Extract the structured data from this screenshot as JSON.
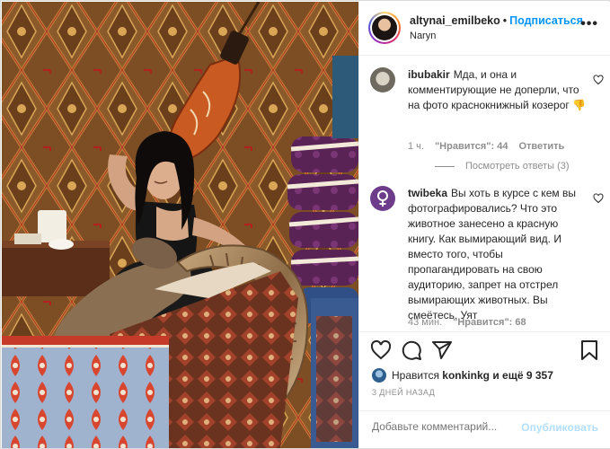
{
  "post": {
    "username": "altynai_emilbeko",
    "separator": "•",
    "follow_label": "Подписаться",
    "location": "Naryn",
    "more_glyph": "•••"
  },
  "comments": [
    {
      "username": "ibubakir",
      "text": "Мда, и она и комментирующие не доперли, что на фото краснокнижный козерог 👎",
      "time": "1 ч.",
      "likes": "\"Нравится\": 44",
      "reply": "Ответить"
    },
    {
      "username": "twibeka",
      "text": "Вы хоть в курсе с кем вы фотографировались? Что это животное занесено а красную книгу. Как вымирающий вид. И вместо того, чтобы пропагандировать на свою аудиторию, запрет на отстрел вымирающих животных. Вы смеётесь. Уят",
      "time": "43 мин.",
      "likes": "\"Нравится\": 68"
    }
  ],
  "replies_label": "Посмотреть ответы (3)",
  "likes": {
    "prefix": "Нравится",
    "user": "konkinkg",
    "and_more": "и ещё 9 357"
  },
  "date": "3 ДНЕЙ НАЗАД",
  "add_comment": {
    "placeholder": "Добавьте комментарий...",
    "publish_label": "Опубликовать"
  },
  "colors": {
    "accent": "#0095f6",
    "publish_disabled": "#b2dffc",
    "muted": "#8e8e8e"
  },
  "icons": [
    "more-icon",
    "heart-icon",
    "comment-icon",
    "share-icon",
    "bookmark-icon"
  ]
}
